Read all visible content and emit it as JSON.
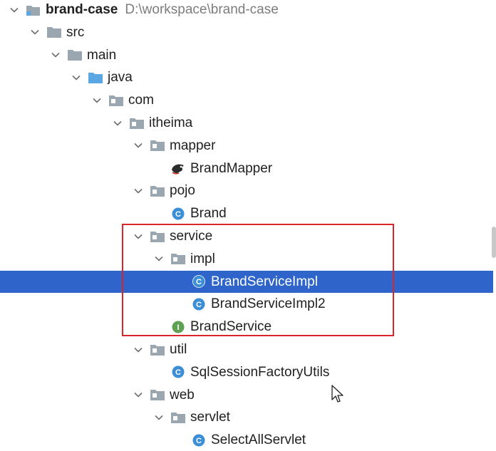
{
  "project_tree": {
    "items": [
      {
        "label": "brand-case",
        "path": "D:\\workspace\\brand-case",
        "icon": "project-folder-icon",
        "depth": 0,
        "expanded": true,
        "bold": true
      },
      {
        "label": "src",
        "icon": "folder-icon",
        "depth": 1,
        "expanded": true
      },
      {
        "label": "main",
        "icon": "folder-icon",
        "depth": 2,
        "expanded": true
      },
      {
        "label": "java",
        "icon": "source-root-folder-icon",
        "depth": 3,
        "expanded": true
      },
      {
        "label": "com",
        "icon": "package-icon",
        "depth": 4,
        "expanded": true
      },
      {
        "label": "itheima",
        "icon": "package-icon",
        "depth": 5,
        "expanded": true
      },
      {
        "label": "mapper",
        "icon": "package-icon",
        "depth": 6,
        "expanded": true
      },
      {
        "label": "BrandMapper",
        "icon": "mybatis-mapper-icon",
        "depth": 7
      },
      {
        "label": "pojo",
        "icon": "package-icon",
        "depth": 6,
        "expanded": true
      },
      {
        "label": "Brand",
        "icon": "class-icon",
        "depth": 7
      },
      {
        "label": "service",
        "icon": "package-icon",
        "depth": 6,
        "expanded": true
      },
      {
        "label": "impl",
        "icon": "package-icon",
        "depth": 7,
        "expanded": true
      },
      {
        "label": "BrandServiceImpl",
        "icon": "class-icon",
        "depth": 8,
        "selected": true
      },
      {
        "label": "BrandServiceImpl2",
        "icon": "class-icon",
        "depth": 8
      },
      {
        "label": "BrandService",
        "icon": "interface-icon",
        "depth": 7
      },
      {
        "label": "util",
        "icon": "package-icon",
        "depth": 6,
        "expanded": true
      },
      {
        "label": "SqlSessionFactoryUtils",
        "icon": "class-icon",
        "depth": 7
      },
      {
        "label": "web",
        "icon": "package-icon",
        "depth": 6,
        "expanded": true
      },
      {
        "label": "servlet",
        "icon": "package-icon",
        "depth": 7,
        "expanded": true
      },
      {
        "label": "SelectAllServlet",
        "icon": "class-icon",
        "depth": 8
      }
    ]
  },
  "colors": {
    "selection": "#2f65ca",
    "highlight_box": "#d9262b",
    "folder": "#9aa7b0",
    "source_root": "#5ba7e3",
    "class_icon": "#3c8fd6",
    "interface_icon": "#5fa052",
    "path_text": "#7d7d7d"
  }
}
